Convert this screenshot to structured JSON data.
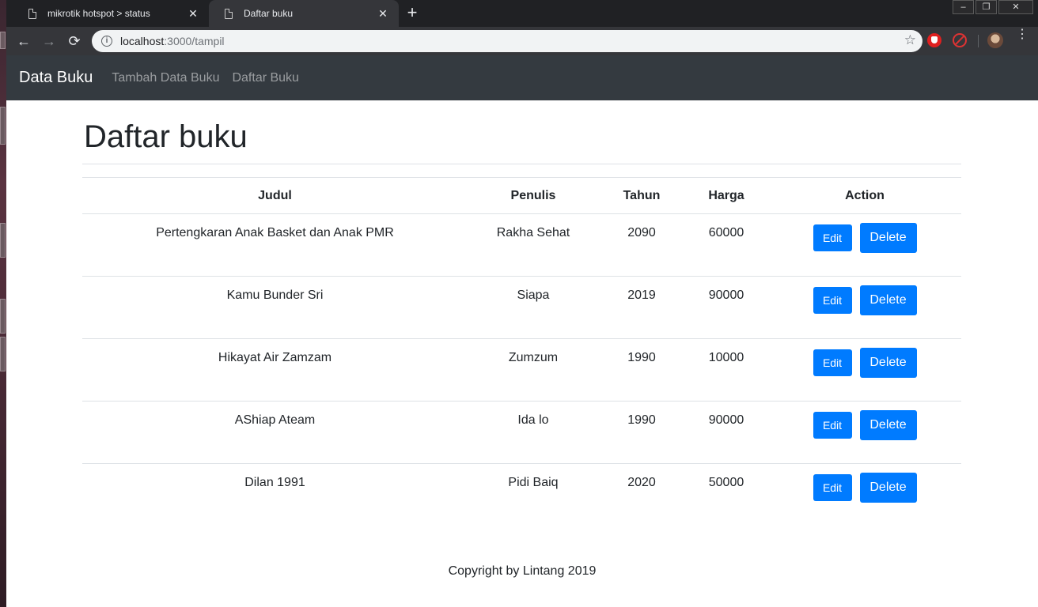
{
  "browser": {
    "tabs": [
      {
        "title": "mikrotik hotspot > status",
        "close": "✕"
      },
      {
        "title": "Daftar buku",
        "close": "✕"
      }
    ],
    "new_tab": "+",
    "url_host": "localhost",
    "url_path": ":3000/tampil",
    "icons": [
      "back-icon",
      "forward-icon",
      "reload-icon",
      "info-icon",
      "star-icon",
      "menu-icon"
    ]
  },
  "navbar": {
    "brand": "Data Buku",
    "links": [
      "Tambah Data Buku",
      "Daftar Buku"
    ]
  },
  "page": {
    "title": "Daftar buku",
    "columns": [
      "Judul",
      "Penulis",
      "Tahun",
      "Harga",
      "Action"
    ],
    "rows": [
      {
        "judul": "Pertengkaran Anak Basket dan Anak PMR",
        "penulis": "Rakha Sehat",
        "tahun": "2090",
        "harga": "60000"
      },
      {
        "judul": "Kamu Bunder Sri",
        "penulis": "Siapa",
        "tahun": "2019",
        "harga": "90000"
      },
      {
        "judul": "Hikayat Air Zamzam",
        "penulis": "Zumzum",
        "tahun": "1990",
        "harga": "10000"
      },
      {
        "judul": "AShiap Ateam",
        "penulis": "Ida lo",
        "tahun": "1990",
        "harga": "90000"
      },
      {
        "judul": "Dilan 1991",
        "penulis": "Pidi Baiq",
        "tahun": "2020",
        "harga": "50000"
      }
    ],
    "edit_label": "Edit",
    "delete_label": "Delete"
  },
  "footer": {
    "text": "Copyright by Lintang 2019"
  },
  "colors": {
    "navbar": "#343a40",
    "primary": "#007bff",
    "border": "#dee2e6"
  }
}
